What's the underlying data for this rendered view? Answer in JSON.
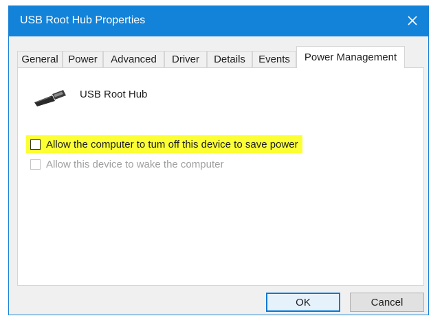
{
  "window": {
    "title": "USB Root Hub Properties",
    "close_icon": "close-icon",
    "titlebar_color": "#1383d9"
  },
  "tabs": [
    {
      "label": "General"
    },
    {
      "label": "Power"
    },
    {
      "label": "Advanced"
    },
    {
      "label": "Driver"
    },
    {
      "label": "Details"
    },
    {
      "label": "Events"
    },
    {
      "label": "Power Management",
      "active": true
    }
  ],
  "device": {
    "icon": "usb-plug-icon",
    "name": "USB Root Hub"
  },
  "options": [
    {
      "label": "Allow the computer to tum off this device to save power",
      "checked": false,
      "enabled": true,
      "highlight_color": "#fcff34"
    },
    {
      "label": "Allow this device to wake the computer",
      "checked": false,
      "enabled": false
    }
  ],
  "buttons": {
    "ok": "OK",
    "cancel": "Cancel"
  }
}
